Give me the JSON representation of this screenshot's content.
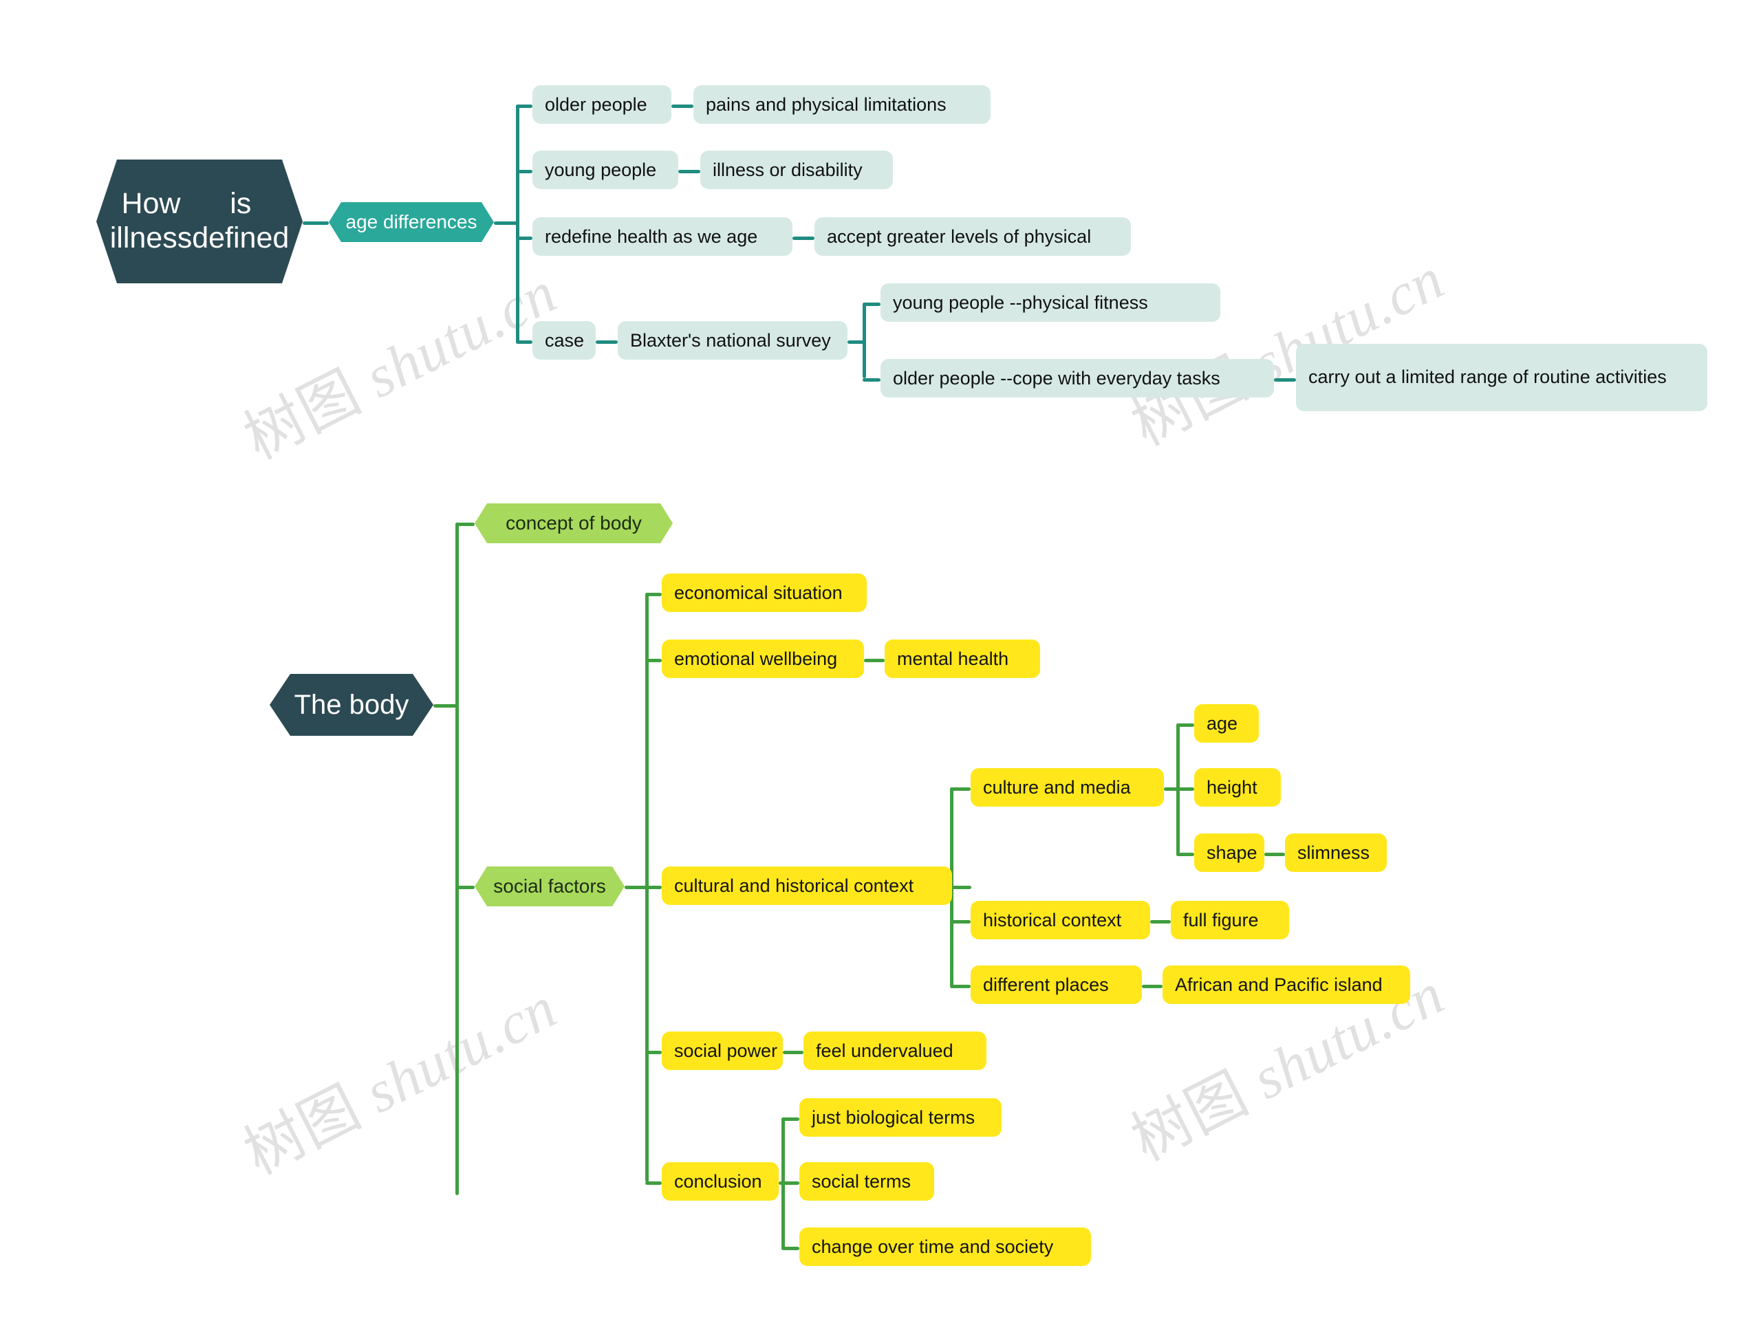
{
  "document": {
    "type": "mindmap",
    "background": "#ffffff"
  },
  "watermark": {
    "text": "树图 shutu.cn",
    "color": "#c9c9c9",
    "rotation_deg": -27,
    "instances": 4
  },
  "palette": {
    "root_fill": "#2c4a53",
    "root_text": "#ffffff",
    "teal_fill": "#2aa89a",
    "teal_text": "#ffffff",
    "teal_line": "#1f8c80",
    "mint_fill": "#d6e9e5",
    "mint_text": "#111111",
    "green_fill": "#a7d95c",
    "green_text": "#1d2b12",
    "green_line": "#3f9e3f",
    "yellow_fill": "#ffe71c",
    "yellow_text": "#141414"
  },
  "map1": {
    "root": {
      "line1": "How illness",
      "line2": "is defined"
    },
    "branch": {
      "label": "age differences"
    },
    "children": [
      {
        "label": "older people",
        "child": "pains and physical limitations"
      },
      {
        "label": "young people",
        "child": "illness or disability"
      },
      {
        "label": "redefine health as we age",
        "child": "accept greater levels of physical"
      },
      {
        "label": "case",
        "child": "Blaxter's national survey"
      }
    ],
    "survey_children": [
      {
        "label": "young people --physical fitness"
      },
      {
        "label": "older people --cope with everyday tasks",
        "child": "carry out a limited range of routine activities"
      }
    ]
  },
  "map2": {
    "root": {
      "label": "The body"
    },
    "branches": [
      {
        "label": "concept of body"
      },
      {
        "label": "social factors"
      }
    ],
    "social_factors": [
      {
        "label": "economical situation"
      },
      {
        "label": "emotional wellbeing",
        "child": "mental health"
      },
      {
        "label": "cultural and historical context"
      },
      {
        "label": "social power",
        "child": "feel undervalued"
      },
      {
        "label": "conclusion"
      }
    ],
    "cultural_children": [
      {
        "label": "culture and media"
      },
      {
        "label": "historical context",
        "child": "full figure"
      },
      {
        "label": "different places",
        "child": "African and Pacific island"
      }
    ],
    "culture_media_children": [
      {
        "label": "age"
      },
      {
        "label": "height"
      },
      {
        "label": "shape",
        "child": "slimness"
      }
    ],
    "conclusion_children": [
      {
        "label": "just biological terms"
      },
      {
        "label": "social terms"
      },
      {
        "label": "change over time and society"
      }
    ]
  }
}
